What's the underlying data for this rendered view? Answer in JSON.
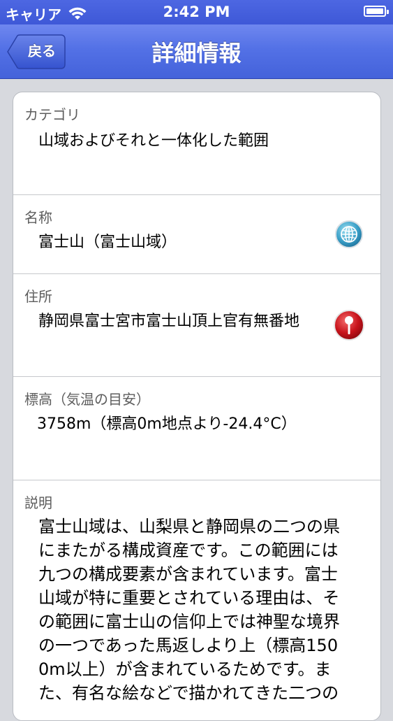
{
  "status_bar": {
    "carrier": "キャリア",
    "time": "2:42 PM"
  },
  "nav": {
    "back_label": "戻る",
    "title": "詳細情報"
  },
  "details": {
    "category": {
      "label": "カテゴリ",
      "value": "山域およびそれと一体化した範囲"
    },
    "name": {
      "label": "名称",
      "value": "富士山（富士山域）"
    },
    "address": {
      "label": "住所",
      "value": "静岡県富士宮市富士山頂上官有無番地"
    },
    "elevation": {
      "label": "標高（気温の目安）",
      "value": "3758m（標高0m地点より-24.4°C）"
    },
    "description": {
      "label": "説明",
      "lines": [
        "富士山域は、山梨県と静岡県の二つの県",
        "にまたがる構成資産です。この範囲には",
        "九つの構成要素が含まれています。富士",
        "山域が特に重要とされている理由は、そ",
        "の範囲に富士山の信仰上では神聖な境界",
        "の一つであった馬返しより上（標高150",
        "0m以上）が含まれているためです。ま",
        "た、有名な絵などで描かれてきた二つの"
      ]
    }
  },
  "icons": {
    "wifi": "wifi-icon",
    "battery": "battery-icon",
    "globe": "globe-icon",
    "map_pin": "map-pin-icon"
  },
  "colors": {
    "nav_blue": "#5371e6",
    "globe_teal": "#3aa0c8",
    "pin_red": "#c8141c"
  }
}
